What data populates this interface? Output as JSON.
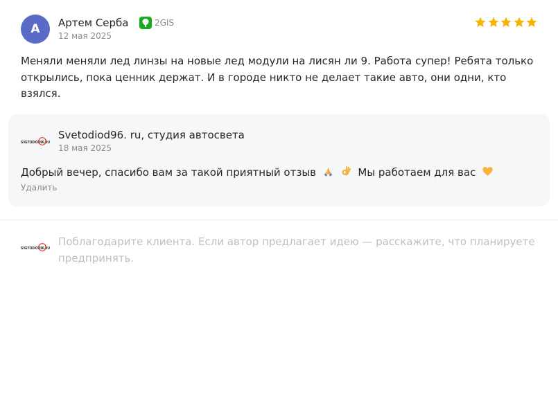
{
  "review": {
    "avatar_letter": "А",
    "author": "Артем Серба",
    "source_label": "2GIS",
    "date": "12 мая 2025",
    "rating": 5,
    "text": "Меняли меняли лед линзы на новые лед модули на лисян ли 9. Работа супер! Ребята только открылись, пока ценник держат. И в городе никто не делает такие авто, они одни, кто взялся."
  },
  "reply": {
    "company": "Svetodiod96. ru, студия автосвета",
    "logo_text": "SVETODIOD96.RU",
    "date": "18 мая 2025",
    "text": "Добрый вечер, спасибо вам за такой приятный отзыв",
    "text_suffix": "Мы работаем для вас",
    "delete_label": "Удалить"
  },
  "compose": {
    "placeholder": "Поблагодарите клиента. Если автор предлагает идею — расскажите, что планируете предпринять."
  },
  "colors": {
    "avatar": "#5a6bc7",
    "star": "#f5b400",
    "gis_badge": "#19aa1e",
    "reply_bg": "#f6f7f8"
  },
  "icons": {
    "source": "2gis-icon",
    "star": "star-icon",
    "emoji_1": "folded-hands-icon",
    "emoji_2": "ok-hand-icon",
    "emoji_3": "yellow-heart-icon"
  }
}
